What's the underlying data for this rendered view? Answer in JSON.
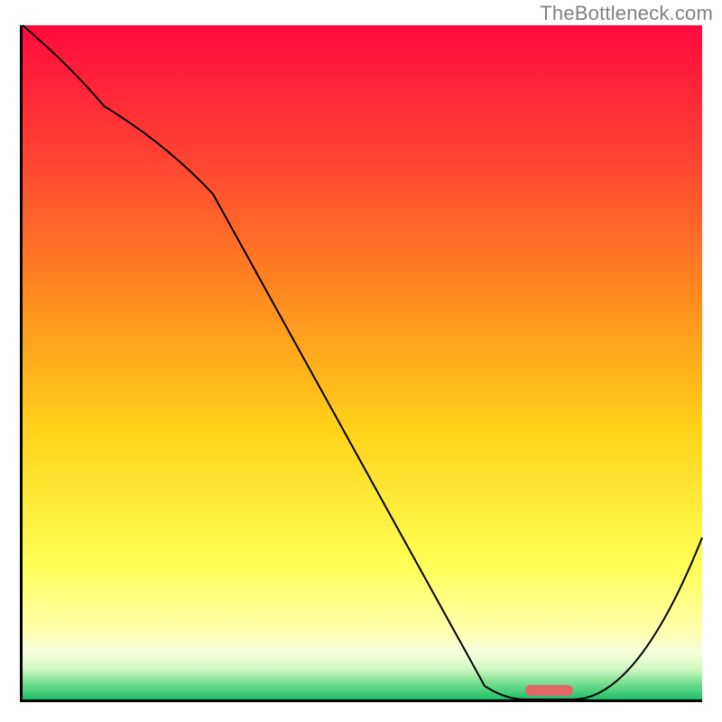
{
  "watermark": "TheBottleneck.com",
  "chart_data": {
    "type": "line",
    "title": "",
    "xlabel": "",
    "ylabel": "",
    "xlim": [
      0,
      100
    ],
    "ylim": [
      0,
      100
    ],
    "grid": false,
    "legend": false,
    "gradient_stops": [
      {
        "pos": 0.0,
        "color": "#ff0a3c"
      },
      {
        "pos": 0.2,
        "color": "#ff4433"
      },
      {
        "pos": 0.4,
        "color": "#ff8a1f"
      },
      {
        "pos": 0.6,
        "color": "#ffd21a"
      },
      {
        "pos": 0.8,
        "color": "#ffff55"
      },
      {
        "pos": 0.9,
        "color": "#ffffb0"
      },
      {
        "pos": 0.93,
        "color": "#f7ffdd"
      },
      {
        "pos": 0.955,
        "color": "#d0f7c0"
      },
      {
        "pos": 0.975,
        "color": "#7ae090"
      },
      {
        "pos": 1.0,
        "color": "#1fbf6a"
      }
    ],
    "series": [
      {
        "name": "bottleneck-curve",
        "x": [
          0,
          12,
          28,
          68,
          74,
          81,
          100
        ],
        "y": [
          100,
          88,
          75,
          2,
          0,
          0,
          24
        ],
        "note": "y is percent of vertical range; valley floor sits at ~0 between x≈74–81"
      }
    ],
    "optimal_marker": {
      "x_start": 74,
      "x_end": 81,
      "y": 0.5,
      "color": "#e06666"
    }
  }
}
